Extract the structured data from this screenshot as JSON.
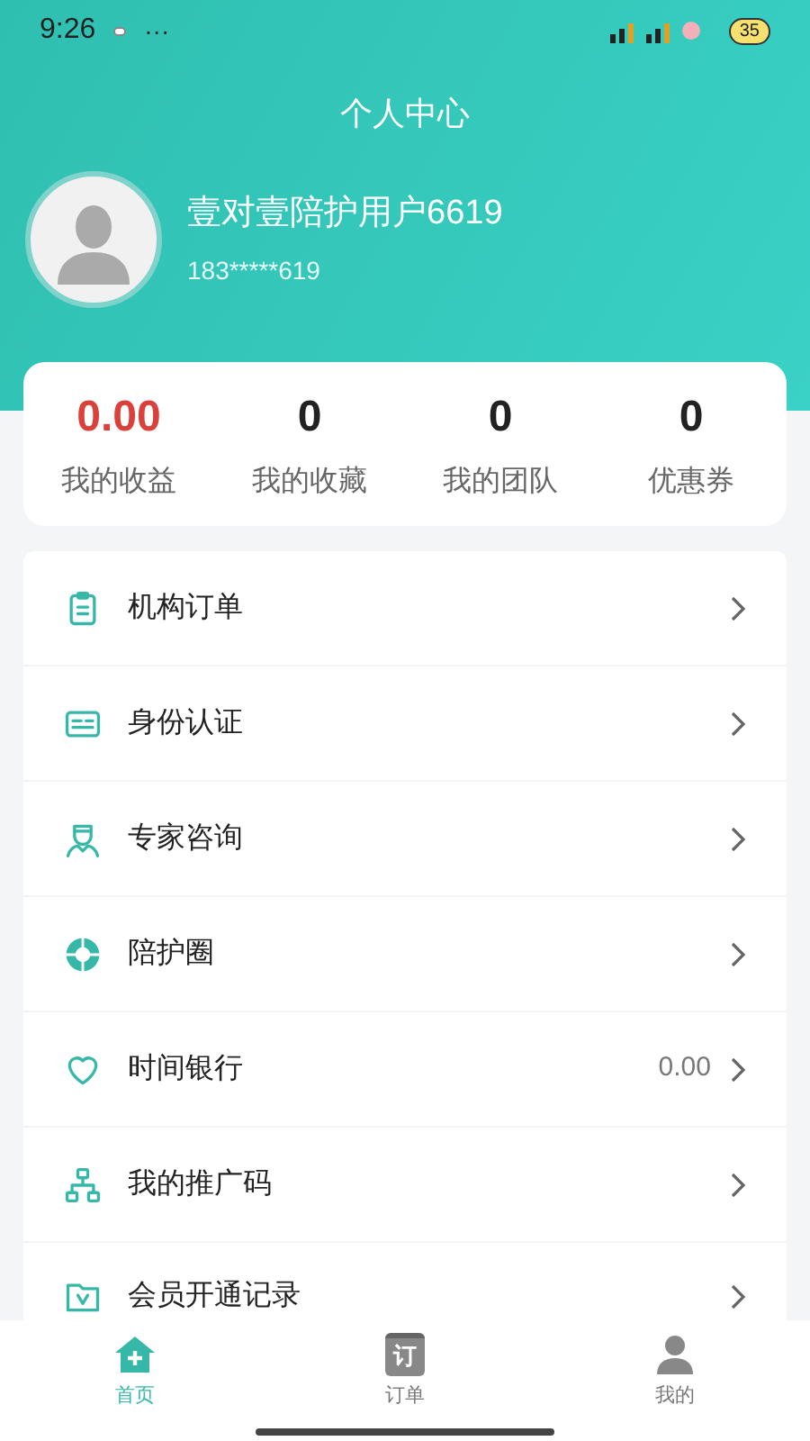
{
  "status_bar": {
    "time": "9:26",
    "dots": "···",
    "battery": "35"
  },
  "header": {
    "title": "个人中心"
  },
  "profile": {
    "name": "壹对壹陪护用户6619",
    "phone": "183*****619"
  },
  "stats": [
    {
      "value": "0.00",
      "label": "我的收益",
      "highlight": true
    },
    {
      "value": "0",
      "label": "我的收藏",
      "highlight": false
    },
    {
      "value": "0",
      "label": "我的团队",
      "highlight": false
    },
    {
      "value": "0",
      "label": "优惠券",
      "highlight": false
    }
  ],
  "menu": [
    {
      "kind": "clipboard",
      "label": "机构订单"
    },
    {
      "kind": "idcard",
      "label": "身份认证"
    },
    {
      "kind": "doctor",
      "label": "专家咨询"
    },
    {
      "kind": "aperture",
      "label": "陪护圈"
    },
    {
      "kind": "heart",
      "label": "时间银行",
      "value": "0.00"
    },
    {
      "kind": "network",
      "label": "我的推广码"
    },
    {
      "kind": "vip",
      "label": "会员开通记录"
    }
  ],
  "tab_bar": [
    {
      "kind": "home",
      "label": "首页",
      "selected": true
    },
    {
      "kind": "order",
      "label": "订单",
      "icon_text": "订",
      "selected": false
    },
    {
      "kind": "user",
      "label": "我的",
      "selected": false
    }
  ]
}
